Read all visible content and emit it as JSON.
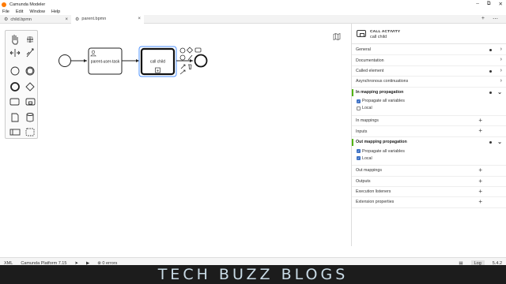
{
  "window": {
    "title": "Camunda Modeler",
    "controls": [
      "–",
      "⧉",
      "✕"
    ]
  },
  "menu": [
    "File",
    "Edit",
    "Window",
    "Help"
  ],
  "tabs": [
    {
      "label": "child.bpmn",
      "close": "×"
    },
    {
      "label": "parent.bpmn",
      "close": "×"
    }
  ],
  "tab_actions": {
    "add": "+",
    "more": "⋯"
  },
  "diagram": {
    "task_label": "parent-user-task",
    "call_activity_label": "call child",
    "subprocess_marker": "+"
  },
  "panel": {
    "element_type": "CALL ACTIVITY",
    "element_name": "call child",
    "groups": {
      "general": "General",
      "documentation": "Documentation",
      "called_element": "Called element",
      "async": "Asynchronous continuations",
      "in_mapping_propagation": "In mapping propagation",
      "in_mappings": "In mappings",
      "inputs": "Inputs",
      "out_mapping_propagation": "Out mapping propagation",
      "out_mappings": "Out mappings",
      "outputs": "Outputs",
      "execution_listeners": "Execution listeners",
      "extension_properties": "Extension properties"
    },
    "in_propagation": {
      "propagate_all": {
        "label": "Propagate all variables",
        "checked": true
      },
      "local": {
        "label": "Local",
        "checked": false
      }
    },
    "out_propagation": {
      "propagate_all": {
        "label": "Propagate all variables",
        "checked": true
      },
      "local": {
        "label": "Local",
        "checked": true
      }
    },
    "chevron": "›",
    "chevron_open": "⌄",
    "plus": "+"
  },
  "status": {
    "xml": "XML",
    "platform": "Camunda Platform 7.15",
    "errors": "0 errors",
    "log": "Log",
    "version": "5.4.2"
  },
  "watermark": "TECH BUZZ BLOGS",
  "colors": {
    "accent": "#52b415",
    "selection": "#4d90fe",
    "checkbox": "#3b6fc4"
  }
}
